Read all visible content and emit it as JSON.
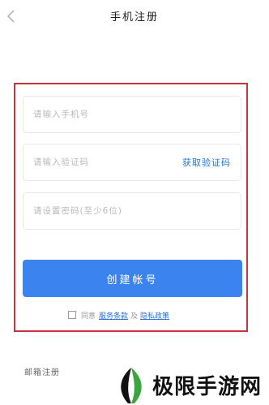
{
  "header": {
    "title": "手机注册",
    "back_icon": "chevron-left-icon"
  },
  "form": {
    "highlight_color": "#c8343b",
    "phone_placeholder": "请输入手机号",
    "code_placeholder": "请输入验证码",
    "get_code_label": "获取验证码",
    "password_placeholder": "请设置密码(至少6位)",
    "submit_label": "创建帐号",
    "submit_color": "#3b84f0"
  },
  "agreement": {
    "checked": false,
    "prefix": "同意",
    "terms_label": "服务条款",
    "and_text": "及",
    "privacy_label": "隐私政策"
  },
  "footer": {
    "email_register_label": "邮箱注册",
    "watermark_text": "极限手游网"
  }
}
